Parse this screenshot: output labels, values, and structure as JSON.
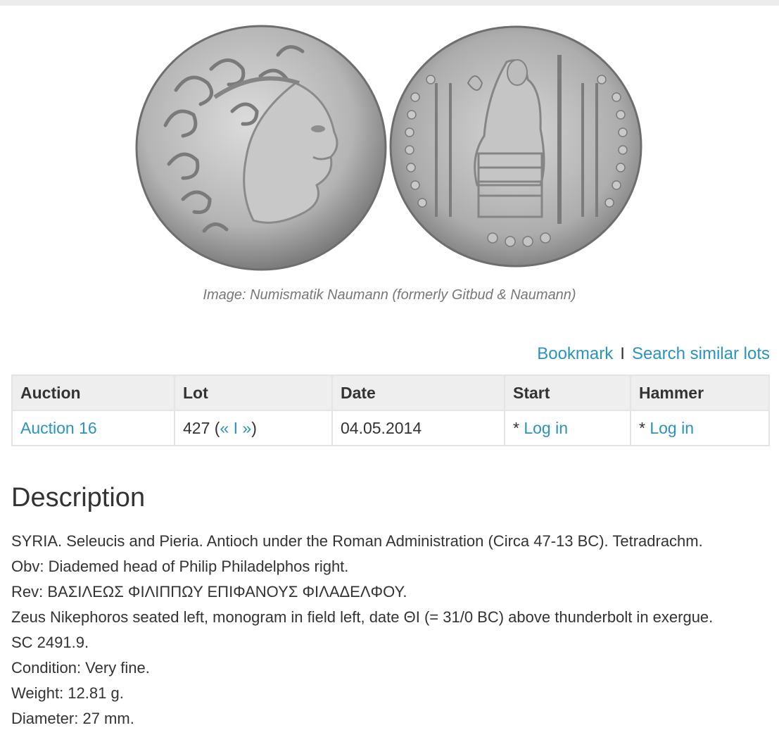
{
  "image": {
    "caption": "Image: Numismatik Naumann (formerly Gitbud & Naumann)"
  },
  "actions": {
    "bookmark": "Bookmark",
    "separator": "I",
    "search_similar": "Search similar lots"
  },
  "lot_table": {
    "headers": [
      "Auction",
      "Lot",
      "Date",
      "Start",
      "Hammer"
    ],
    "row": {
      "auction": "Auction 16",
      "lot_number": "427 (",
      "prev": "«",
      "nav_sep": " I ",
      "next": "»",
      "lot_close": ")",
      "date": "04.05.2014",
      "start_prefix": "* ",
      "start_link": "Log in",
      "hammer_prefix": "* ",
      "hammer_link": "Log in"
    }
  },
  "description": {
    "title": "Description",
    "lines": [
      "SYRIA. Seleucis and Pieria. Antioch under the Roman Administration (Circa 47-13 BC). Tetradrachm.",
      "Obv: Diademed head of Philip Philadelphos right.",
      "Rev: ΒΑΣΙΛΕΩΣ ΦΙΛΙΠΠΩΥ ΕΠΙΦΑΝΟΥΣ ΦΙΛΑΔΕΛΦΟΥ.",
      "Zeus Nikephoros seated left, monogram in field left, date ΘΙ (= 31/0 BC) above thunderbolt in exergue.",
      "SC 2491.9.",
      "Condition: Very fine.",
      "Weight: 12.81 g.",
      "Diameter: 27 mm."
    ]
  },
  "colors": {
    "link": "#2a93c0",
    "text": "#333333",
    "caption": "#777777",
    "table_header_bg": "#eeeeee",
    "table_border": "#e4e4e4",
    "coin_silver": "#b4b4b4"
  }
}
